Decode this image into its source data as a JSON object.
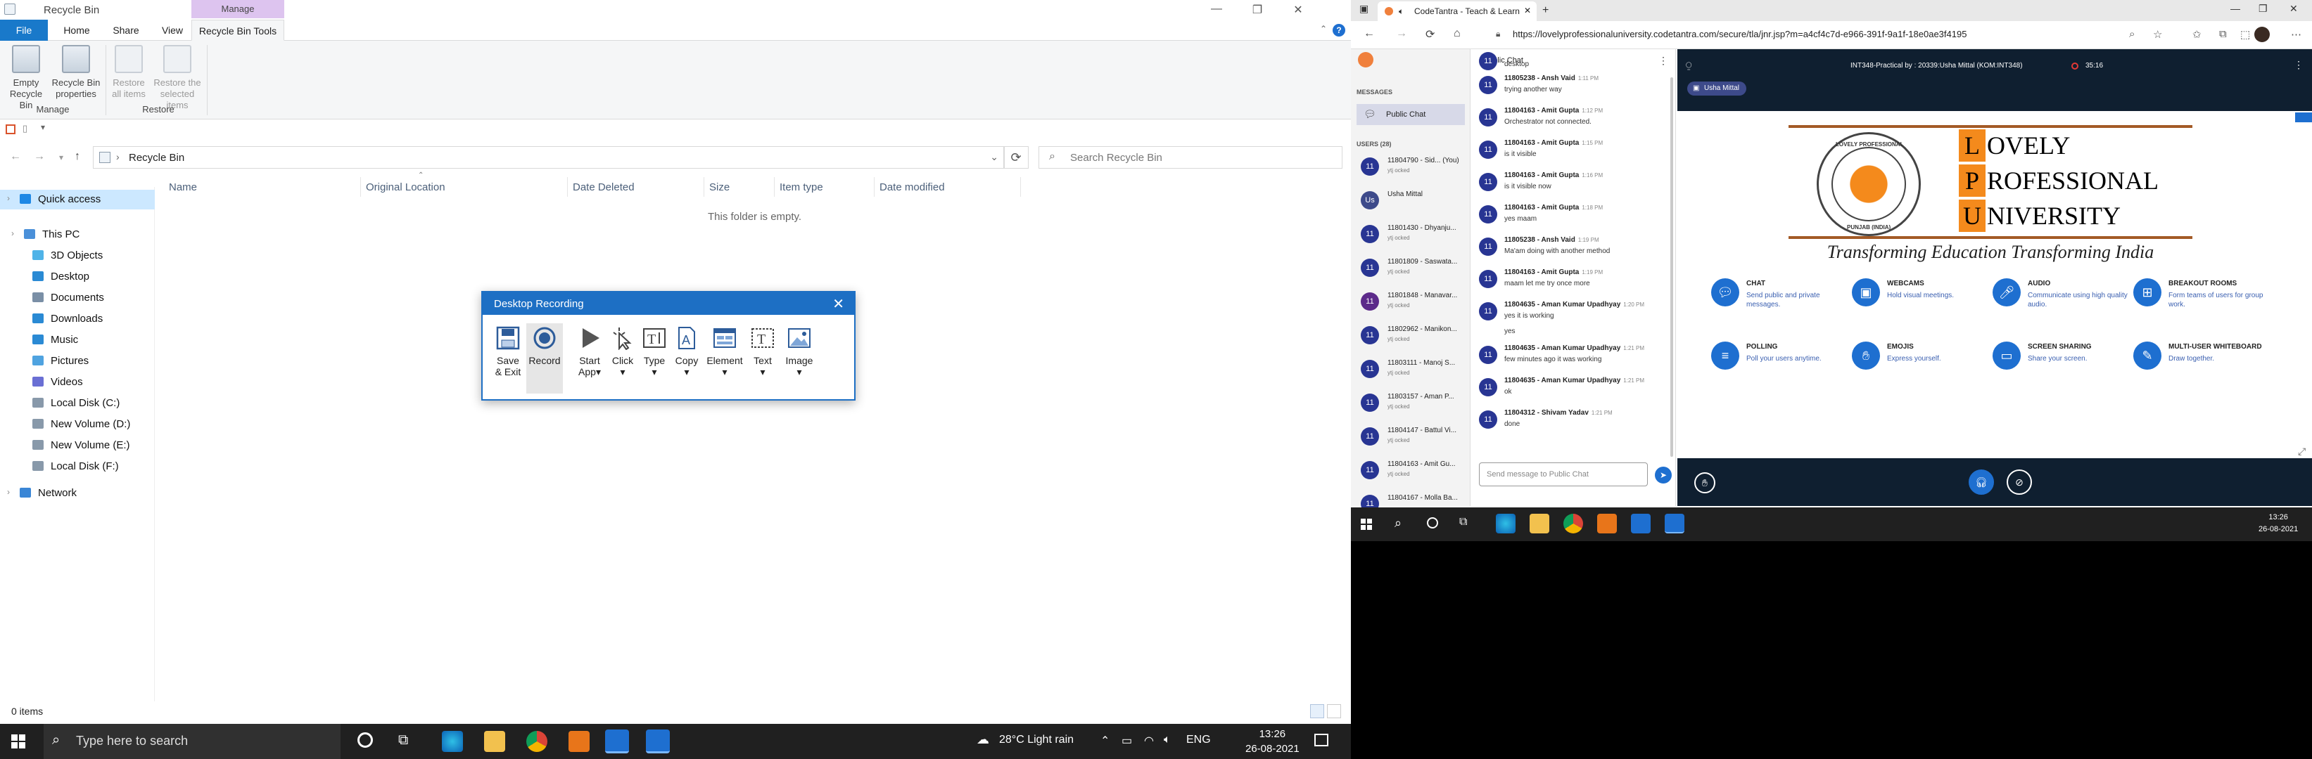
{
  "explorer": {
    "title": "Recycle Bin",
    "manage_context_tab": "Manage",
    "ribbon_tabs": [
      "File",
      "Home",
      "Share",
      "View",
      "Recycle Bin Tools"
    ],
    "ribbon_groups": {
      "manage": {
        "label": "Manage",
        "buttons": [
          "Empty Recycle Bin",
          "Recycle Bin properties"
        ]
      },
      "restore": {
        "label": "Restore",
        "buttons": [
          "Restore all items",
          "Restore the selected items"
        ]
      }
    },
    "address": {
      "path": "Recycle Bin",
      "separator": "›"
    },
    "search": {
      "placeholder": "Search Recycle Bin"
    },
    "nav_items": [
      {
        "label": "Quick access",
        "icon": "star-icon",
        "color": "#1e88e5"
      },
      {
        "label": "This PC",
        "icon": "computer-icon",
        "color": "#4a90d9"
      },
      {
        "label": "3D Objects",
        "icon": "cube-icon",
        "color": "#4fb3e8"
      },
      {
        "label": "Desktop",
        "icon": "desktop-icon",
        "color": "#2a8ad4"
      },
      {
        "label": "Documents",
        "icon": "document-icon",
        "color": "#7a8fa6"
      },
      {
        "label": "Downloads",
        "icon": "download-icon",
        "color": "#2a8ad4"
      },
      {
        "label": "Music",
        "icon": "music-icon",
        "color": "#2a8ad4"
      },
      {
        "label": "Pictures",
        "icon": "picture-icon",
        "color": "#4fa3e0"
      },
      {
        "label": "Videos",
        "icon": "video-icon",
        "color": "#6a6fd4"
      },
      {
        "label": "Local Disk (C:)",
        "icon": "drive-icon",
        "color": "#8899aa"
      },
      {
        "label": "New Volume (D:)",
        "icon": "drive-icon",
        "color": "#8899aa"
      },
      {
        "label": "New Volume (E:)",
        "icon": "drive-icon",
        "color": "#8899aa"
      },
      {
        "label": "Local Disk (F:)",
        "icon": "drive-icon",
        "color": "#8899aa"
      },
      {
        "label": "Network",
        "icon": "network-icon",
        "color": "#3a86d6"
      }
    ],
    "columns": [
      "Name",
      "Original Location",
      "Date Deleted",
      "Size",
      "Item type",
      "Date modified"
    ],
    "empty_message": "This folder is empty.",
    "status": "0 items"
  },
  "recording_dialog": {
    "title": "Desktop Recording",
    "tools": [
      {
        "label": "Save",
        "label2": "& Exit",
        "icon": "save-icon"
      },
      {
        "label": "Record",
        "label2": "",
        "icon": "record-icon"
      },
      {
        "label": "Start",
        "label2": "App",
        "icon": "play-icon"
      },
      {
        "label": "Click",
        "label2": "",
        "icon": "pointer-icon"
      },
      {
        "label": "Type",
        "label2": "",
        "icon": "type-icon"
      },
      {
        "label": "Copy",
        "label2": "",
        "icon": "copy-icon"
      },
      {
        "label": "Element",
        "label2": "",
        "icon": "element-icon"
      },
      {
        "label": "Text",
        "label2": "",
        "icon": "text-icon"
      },
      {
        "label": "Image",
        "label2": "",
        "icon": "image-icon"
      }
    ]
  },
  "taskbar": {
    "search_placeholder": "Type here to search",
    "weather": "28°C  Light rain",
    "language": "ENG",
    "time": "13:26",
    "date": "26-08-2021"
  },
  "browser": {
    "tab_title": "CodeTantra - Teach & Learn",
    "url": "https://lovelyprofessionaluniversity.codetantra.com/secure/tla/jnr.jsp?m=a4cf4c7d-e966-391f-9a1f-18e0ae3f4195",
    "messages_label": "MESSAGES",
    "public_chat_label": "Public Chat",
    "users_label": "USERS (28)",
    "users": [
      {
        "initials": "11",
        "name": "11804790 - Sid... (You)",
        "status": "ytj ocked",
        "color": "#283593"
      },
      {
        "initials": "Us",
        "name": "Usha Mittal",
        "status": "",
        "color": "#3d4a8a"
      },
      {
        "initials": "11",
        "name": "11801430 - Dhyanju...",
        "status": "ytj ocked",
        "color": "#283593"
      },
      {
        "initials": "11",
        "name": "11801809 - Saswata...",
        "status": "ytj ocked",
        "color": "#283593"
      },
      {
        "initials": "11",
        "name": "11801848 - Manavar...",
        "status": "ytj ocked",
        "color": "#5c2a8a"
      },
      {
        "initials": "11",
        "name": "11802962 - Manikon...",
        "status": "ytj ocked",
        "color": "#283593"
      },
      {
        "initials": "11",
        "name": "11803111 - Manoj S...",
        "status": "ytj ocked",
        "color": "#283593"
      },
      {
        "initials": "11",
        "name": "11803157 - Aman P...",
        "status": "ytj ocked",
        "color": "#283593"
      },
      {
        "initials": "11",
        "name": "11804147 - Battul Vi...",
        "status": "ytj ocked",
        "color": "#283593"
      },
      {
        "initials": "11",
        "name": "11804163 - Amit Gu...",
        "status": "ytj ocked",
        "color": "#283593"
      },
      {
        "initials": "11",
        "name": "11804167 - Molla Ba...",
        "status": "",
        "color": "#283593"
      }
    ],
    "chat_header": "Public Chat",
    "chat_messages": [
      {
        "who": "",
        "when": "",
        "text": "desktop"
      },
      {
        "who": "11805238 - Ansh Vaid",
        "when": "1:11 PM",
        "text": "trying another way"
      },
      {
        "who": "11804163 - Amit Gupta",
        "when": "1:12 PM",
        "text": "Orchestrator not connected."
      },
      {
        "who": "11804163 - Amit Gupta",
        "when": "1:15 PM",
        "text": "is it visible"
      },
      {
        "who": "11804163 - Amit Gupta",
        "when": "1:16 PM",
        "text": "is it visible now"
      },
      {
        "who": "11804163 - Amit Gupta",
        "when": "1:18 PM",
        "text": "yes maam"
      },
      {
        "who": "11805238 - Ansh Vaid",
        "when": "1:19 PM",
        "text": "Ma'am doing with another method"
      },
      {
        "who": "11804163 - Amit Gupta",
        "when": "1:19 PM",
        "text": "maam let me try once more"
      },
      {
        "who": "11804635 - Aman Kumar Upadhyay",
        "when": "1:20 PM",
        "text": "yes it is working",
        "extra": "yes"
      },
      {
        "who": "11804635 - Aman Kumar Upadhyay",
        "when": "1:21 PM",
        "text": "few minutes ago it was working"
      },
      {
        "who": "11804635 - Aman Kumar Upadhyay",
        "when": "1:21 PM",
        "text": "ok"
      },
      {
        "who": "11804312 - Shivam Yadav",
        "when": "1:21 PM",
        "text": "done"
      }
    ],
    "chat_placeholder": "Send message to Public Chat",
    "session_title": "INT348-Practical by : 20339:Usha Mittal (KOM:INT348)",
    "timer": "35:16",
    "presenter": "Usha Mittal",
    "slide": {
      "letters": [
        "L",
        "P",
        "U"
      ],
      "words": [
        "OVELY",
        "ROFESSIONAL",
        "NIVERSITY"
      ],
      "tagline": "Transforming Education Transforming India",
      "seal_top": "LOVELY PROFESSIONAL",
      "seal_bottom": "PUNJAB (INDIA)",
      "features": [
        {
          "title": "CHAT",
          "desc": "Send public and private messages.",
          "icon": "chat-icon"
        },
        {
          "title": "WEBCAMS",
          "desc": "Hold visual meetings.",
          "icon": "webcam-icon"
        },
        {
          "title": "AUDIO",
          "desc": "Communicate using high quality audio.",
          "icon": "mic-icon"
        },
        {
          "title": "BREAKOUT ROOMS",
          "desc": "Form teams of users for group work.",
          "icon": "breakout-icon"
        },
        {
          "title": "POLLING",
          "desc": "Poll your users anytime.",
          "icon": "poll-icon"
        },
        {
          "title": "EMOJIS",
          "desc": "Express yourself.",
          "icon": "hand-icon"
        },
        {
          "title": "SCREEN SHARING",
          "desc": "Share your screen.",
          "icon": "screen-icon"
        },
        {
          "title": "MULTI-USER WHITEBOARD",
          "desc": "Draw together.",
          "icon": "whiteboard-icon"
        }
      ]
    },
    "right_time": "13:26",
    "right_date": "26-08-2021"
  }
}
